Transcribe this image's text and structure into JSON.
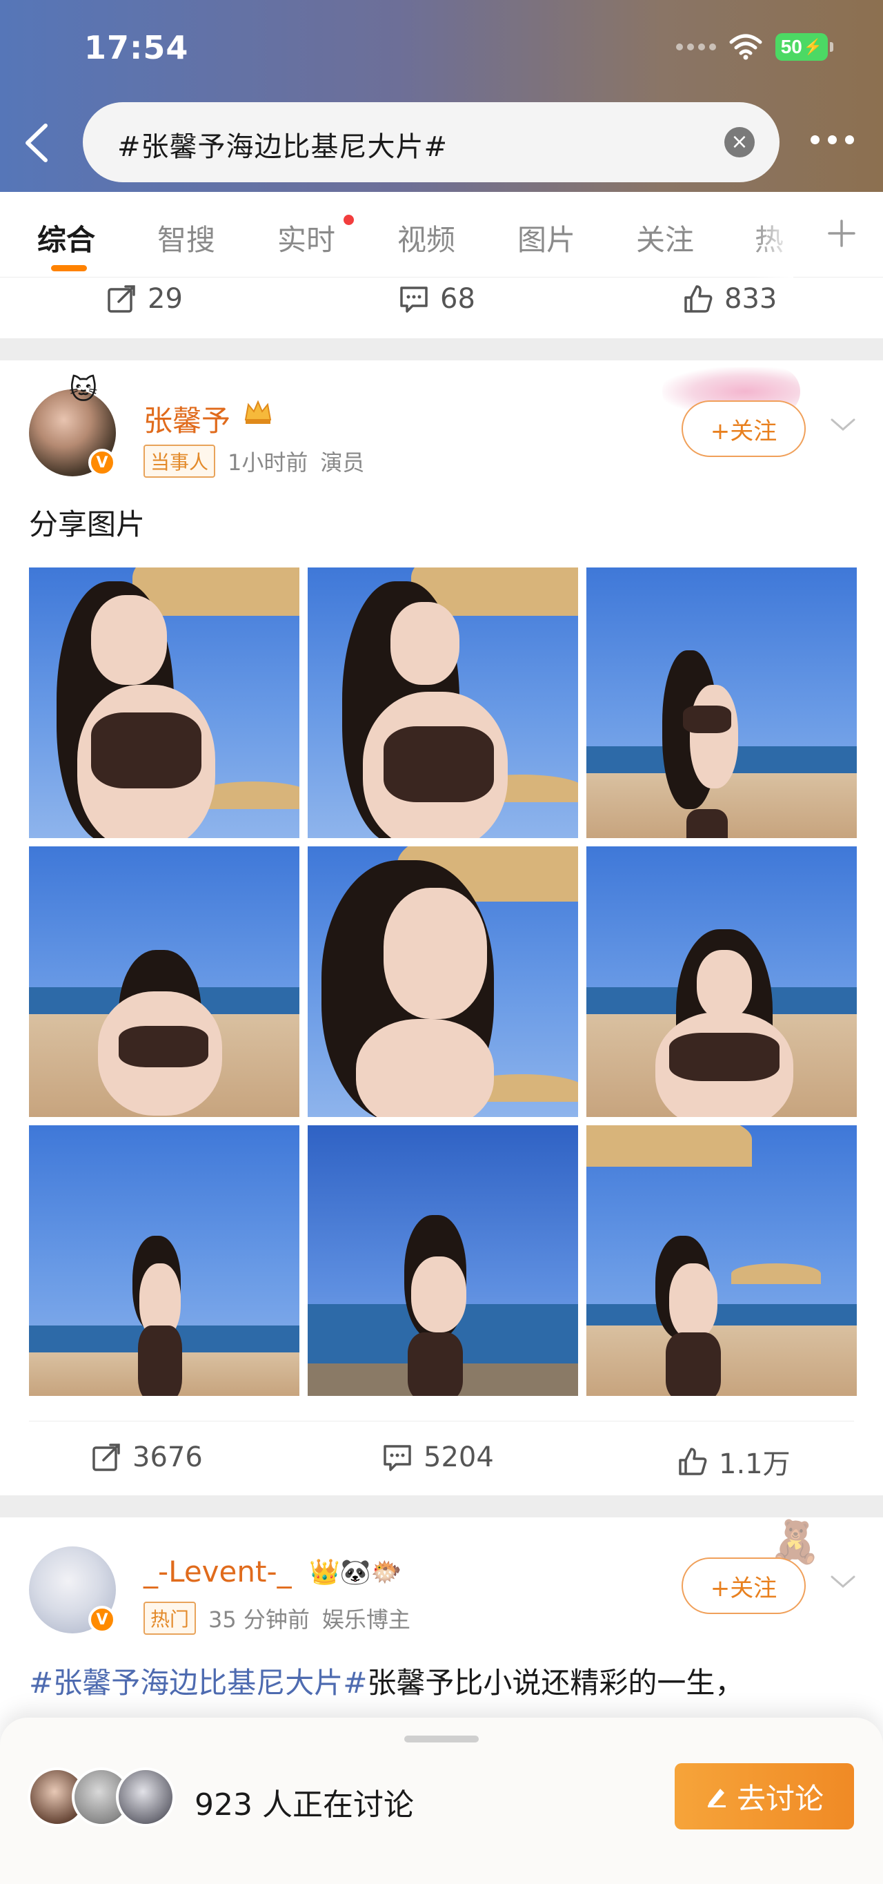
{
  "status_bar": {
    "time": "17:54",
    "battery": "50"
  },
  "search": {
    "query": "#张馨予海边比基尼大片#"
  },
  "tabs": [
    {
      "label": "综合"
    },
    {
      "label": "智搜"
    },
    {
      "label": "实时"
    },
    {
      "label": "视频"
    },
    {
      "label": "图片"
    },
    {
      "label": "关注"
    },
    {
      "label": "热"
    }
  ],
  "prev_post": {
    "reposts": "29",
    "comments": "68",
    "likes": "833"
  },
  "post": {
    "author": "张馨予",
    "tag": "当事人",
    "time": "1小时前",
    "role": "演员",
    "follow_label": "+关注",
    "text": "分享图片",
    "photo_count": 9,
    "reposts": "3676",
    "comments": "5204",
    "likes": "1.1万"
  },
  "post2": {
    "author": "_-Levent-_",
    "tag": "热门",
    "time": "35 分钟前",
    "role": "娱乐博主",
    "follow_label": "+关注",
    "hashtag": "#张馨予海边比基尼大片#",
    "text": "张馨予比小说还精彩的一生，"
  },
  "discussion": {
    "count_text": "923 人正在讨论",
    "button_label": "去讨论"
  },
  "colors": {
    "accent": "#ff8200",
    "author_name": "#e06b1c",
    "hashtag": "#4e6bb0",
    "battery": "#4cd964"
  }
}
